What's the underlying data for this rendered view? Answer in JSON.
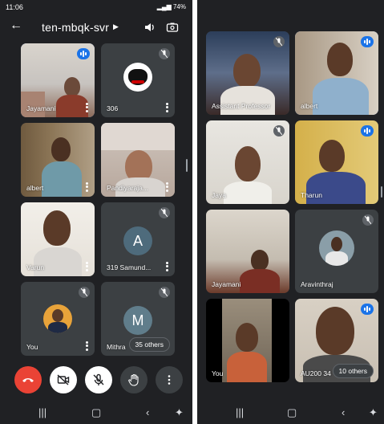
{
  "status_bar": {
    "time": "11:06",
    "battery": "74%"
  },
  "call": {
    "title": "ten-mbqk-svr"
  },
  "colors": {
    "end_call": "#ea4335",
    "active_speaker": "#1a73e8",
    "tile": "#3c4043",
    "background": "#202124"
  },
  "left_tiles": [
    {
      "name": "Jayamani"
    },
    {
      "name": "306"
    },
    {
      "name": "albert"
    },
    {
      "name": "Pandiyaraja..."
    },
    {
      "name": "Varun"
    },
    {
      "name": "319 Samund...",
      "initial": "A"
    },
    {
      "name": "You"
    },
    {
      "name": "Mithra",
      "initial": "M",
      "others": "35 others"
    }
  ],
  "right_tiles": [
    {
      "name": "Assistant Professor"
    },
    {
      "name": "albert"
    },
    {
      "name": "Jaya"
    },
    {
      "name": "Tharun"
    },
    {
      "name": "Jayamani"
    },
    {
      "name": "Aravinthraj"
    },
    {
      "name": "You"
    },
    {
      "name": "AU200 34",
      "others": "10 others"
    }
  ],
  "controls": [
    "end-call",
    "camera-off",
    "mic-off",
    "raise-hand",
    "more"
  ],
  "icons": {
    "back": "arrow-left-icon",
    "speaker": "speaker-icon",
    "switch_camera": "switch-camera-icon"
  }
}
